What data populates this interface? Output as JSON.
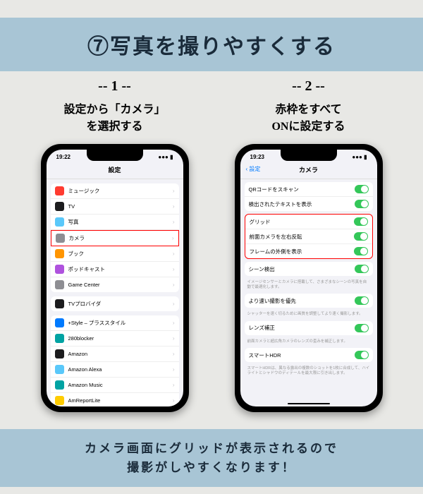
{
  "header": {
    "title": "⑦写真を撮りやすくする"
  },
  "steps": {
    "one": {
      "num": "-- 1 --",
      "desc_l1": "設定から「カメラ」",
      "desc_l2": "を選択する"
    },
    "two": {
      "num": "-- 2 --",
      "desc_l1": "赤枠をすべて",
      "desc_l2": "ONに設定する"
    }
  },
  "phone1": {
    "time": "19:22",
    "nav_title": "設定",
    "group1": [
      {
        "label": "ミュージック",
        "color": "ic-red"
      },
      {
        "label": "TV",
        "color": "ic-dark"
      },
      {
        "label": "写真",
        "color": "ic-ltblue"
      },
      {
        "label": "カメラ",
        "color": "ic-gray",
        "highlight": true
      },
      {
        "label": "ブック",
        "color": "ic-orange"
      },
      {
        "label": "ポッドキャスト",
        "color": "ic-purple"
      },
      {
        "label": "Game Center",
        "color": "ic-gray"
      }
    ],
    "group2": [
      {
        "label": "TVプロバイダ",
        "color": "ic-dark"
      }
    ],
    "group3": [
      {
        "label": "+Style – プラススタイル",
        "color": "ic-blue"
      },
      {
        "label": "280blocker",
        "color": "ic-teal"
      },
      {
        "label": "Amazon",
        "color": "ic-dark"
      },
      {
        "label": "Amazon Alexa",
        "color": "ic-ltblue"
      },
      {
        "label": "Amazon Music",
        "color": "ic-teal"
      },
      {
        "label": "AmReportLite",
        "color": "ic-yellow"
      }
    ]
  },
  "phone2": {
    "time": "19:23",
    "back": "設定",
    "nav_title": "カメラ",
    "g1": [
      {
        "label": "QRコードをスキャン",
        "on": true
      },
      {
        "label": "検出されたテキストを表示",
        "on": true
      }
    ],
    "g2": [
      {
        "label": "グリッド",
        "on": true
      },
      {
        "label": "前面カメラを左右反転",
        "on": true
      },
      {
        "label": "フレームの外側を表示",
        "on": true
      }
    ],
    "g2_highlight": true,
    "g3": [
      {
        "label": "シーン検出",
        "on": true
      }
    ],
    "g3_note": "イメージセンサーとカメラに搭載して、さまざまなシーンの写真を自動で最適化します。",
    "g4": [
      {
        "label": "より速い撮影を優先",
        "on": true
      }
    ],
    "g4_note": "シャッターを速く切るために画質を調整してより速く撮影します。",
    "g5": [
      {
        "label": "レンズ補正",
        "on": true
      }
    ],
    "g5_note": "前面カメラと超広角カメラのレンズの歪みを補正します。",
    "g6": [
      {
        "label": "スマートHDR",
        "on": true
      }
    ],
    "g6_note": "スマートHDRは、異なる露出の複数のショットを1枚に合成して、ハイライトとシャドウのディテールを最大限に引き出します。"
  },
  "footer": {
    "l1": "カメラ画面にグリッドが表示されるので",
    "l2": "撮影がしやすくなります！"
  }
}
